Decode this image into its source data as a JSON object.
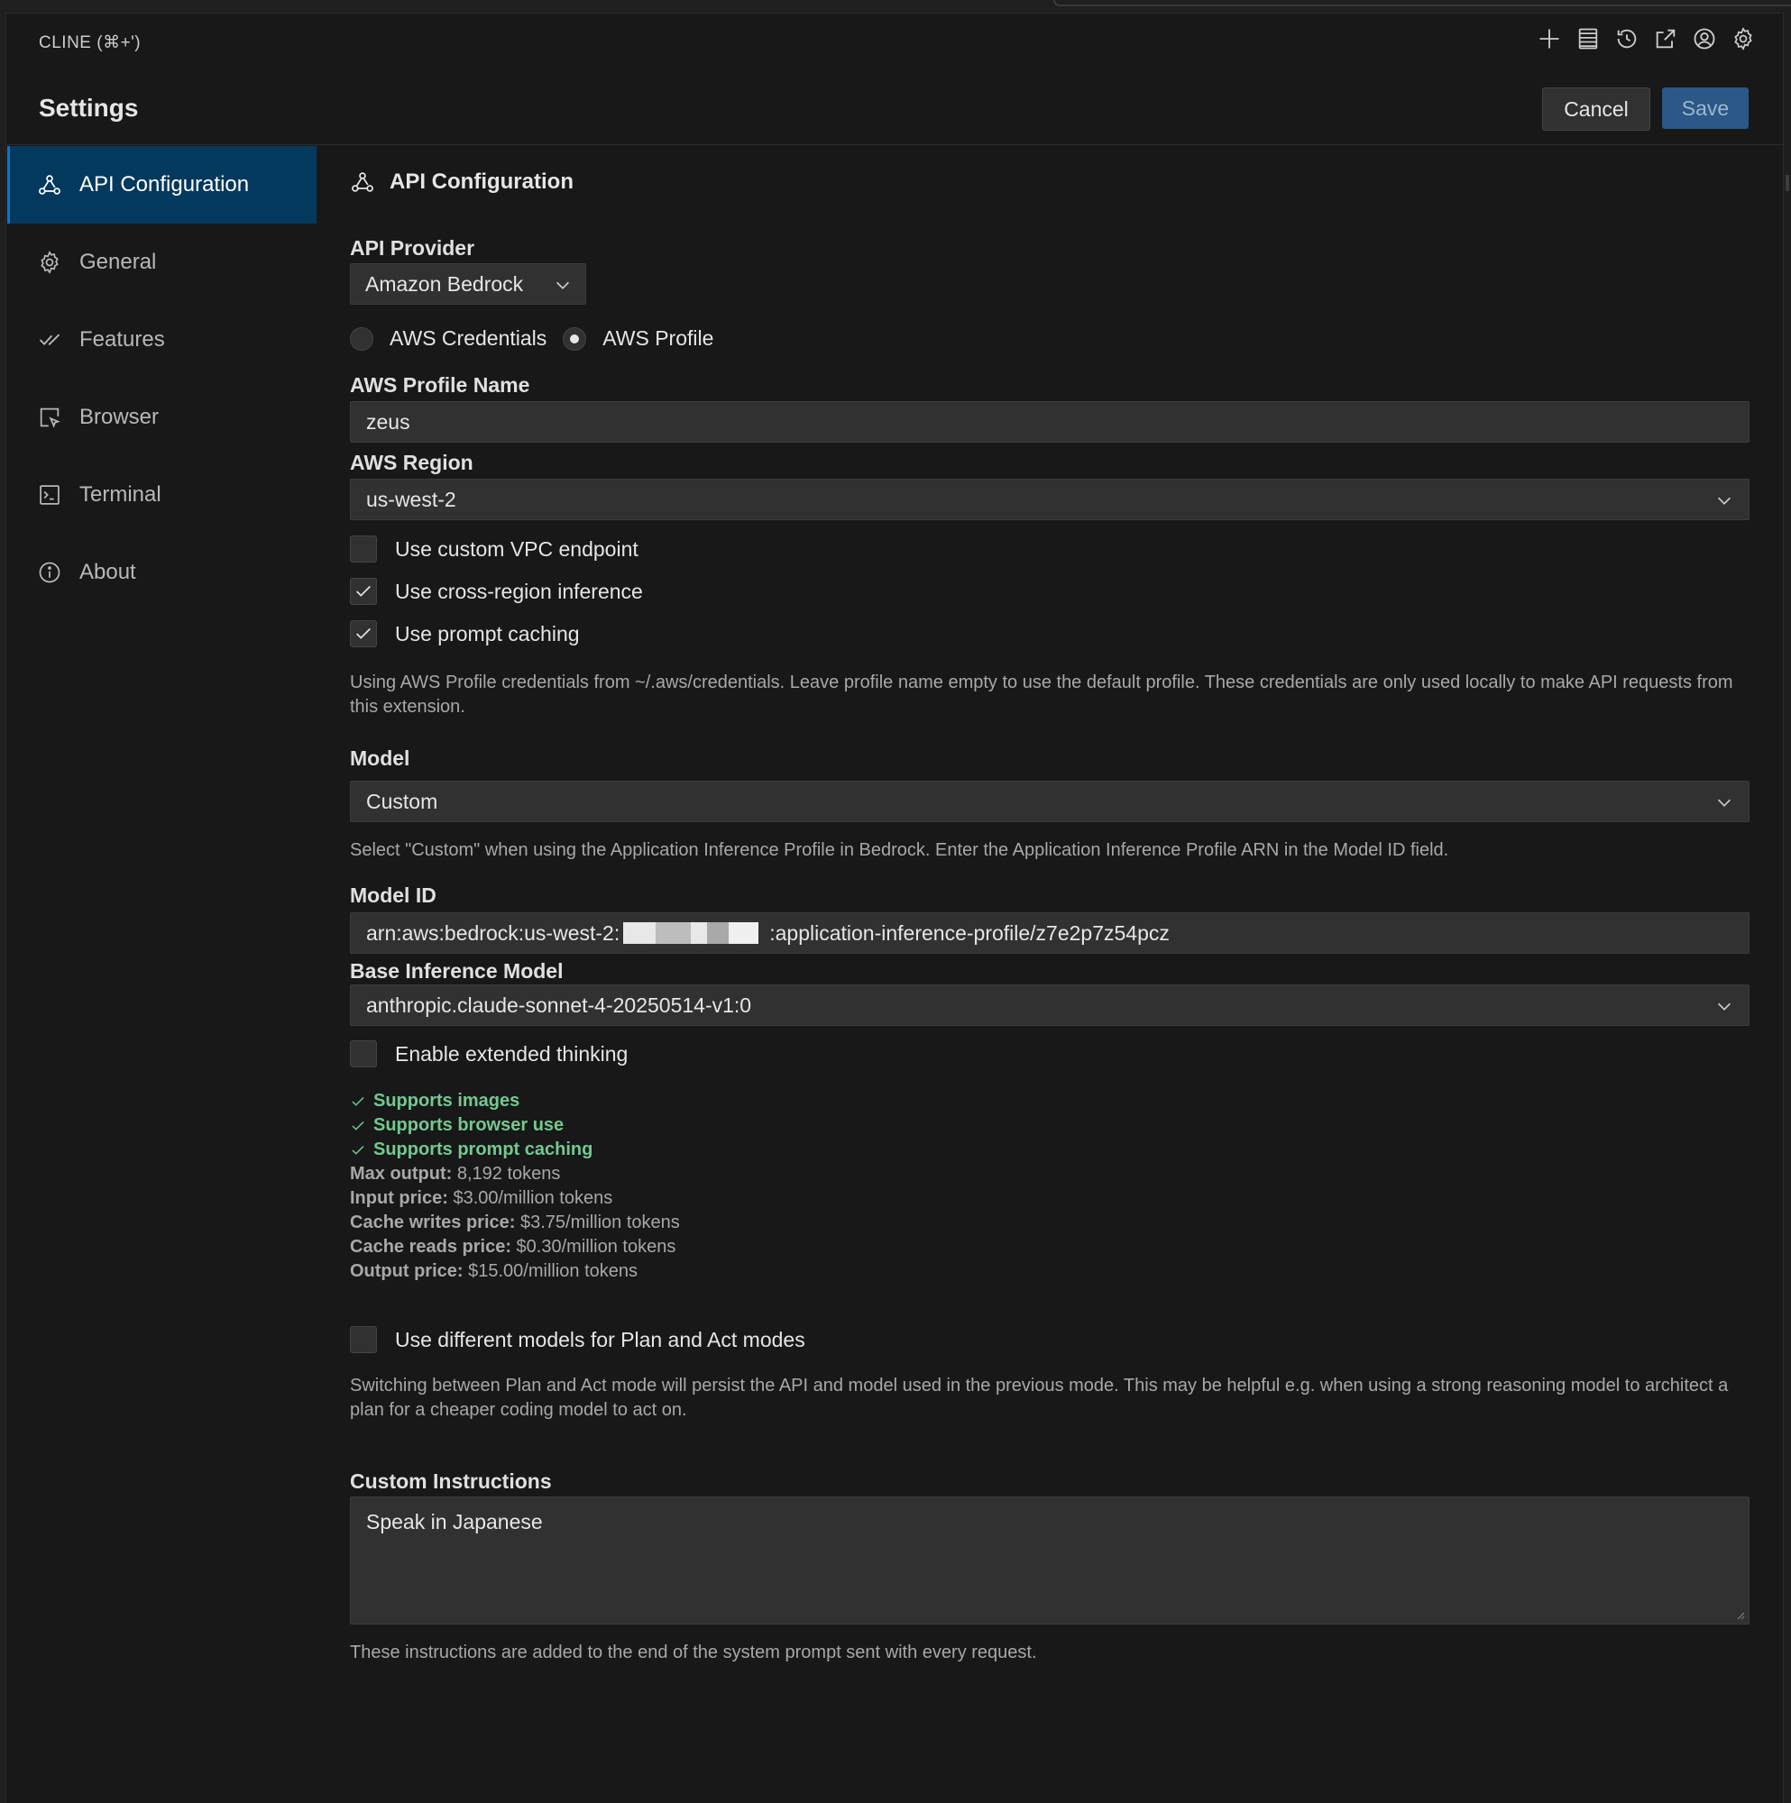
{
  "panel": {
    "title": "CLINE (⌘+')"
  },
  "toolbar": {
    "icons": [
      "plus-icon",
      "server-stack-icon",
      "history-icon",
      "popout-icon",
      "account-icon",
      "gear-icon"
    ]
  },
  "header": {
    "title": "Settings",
    "cancel_label": "Cancel",
    "save_label": "Save"
  },
  "sidebar": {
    "items": [
      {
        "label": "API Configuration",
        "icon": "webhook-icon",
        "active": true
      },
      {
        "label": "General",
        "icon": "gear-icon"
      },
      {
        "label": "Features",
        "icon": "checklist-icon"
      },
      {
        "label": "Browser",
        "icon": "browser-cursor-icon"
      },
      {
        "label": "Terminal",
        "icon": "terminal-icon"
      },
      {
        "label": "About",
        "icon": "info-icon"
      }
    ]
  },
  "main": {
    "section_title": "API Configuration",
    "api_provider": {
      "label": "API Provider",
      "value": "Amazon Bedrock"
    },
    "auth": {
      "option1": "AWS Credentials",
      "option2": "AWS Profile",
      "selected": "AWS Profile"
    },
    "profile_name": {
      "label": "AWS Profile Name",
      "value": "zeus"
    },
    "region": {
      "label": "AWS Region",
      "value": "us-west-2"
    },
    "checks": {
      "vpc": {
        "label": "Use custom VPC endpoint",
        "checked": false
      },
      "cross_region": {
        "label": "Use cross-region inference",
        "checked": true
      },
      "prompt_caching": {
        "label": "Use prompt caching",
        "checked": true
      }
    },
    "profile_note": "Using AWS Profile credentials from ~/.aws/credentials. Leave profile name empty to use the default profile. These credentials are only used locally to make API requests from this extension.",
    "model": {
      "label": "Model",
      "value": "Custom",
      "note": "Select \"Custom\" when using the Application Inference Profile in Bedrock. Enter the Application Inference Profile ARN in the Model ID field."
    },
    "model_id": {
      "label": "Model ID",
      "prefix": "arn:aws:bedrock:us-west-2:",
      "suffix": ":application-inference-profile/z7e2p7z54pcz"
    },
    "base_model": {
      "label": "Base Inference Model",
      "value": "anthropic.claude-sonnet-4-20250514-v1:0"
    },
    "extended_thinking": {
      "label": "Enable extended thinking",
      "checked": false
    },
    "capabilities": [
      "Supports images",
      "Supports browser use",
      "Supports prompt caching"
    ],
    "pricing": [
      {
        "key": "Max output:",
        "value": "8,192 tokens"
      },
      {
        "key": "Input price:",
        "value": "$3.00/million tokens"
      },
      {
        "key": "Cache writes price:",
        "value": "$3.75/million tokens"
      },
      {
        "key": "Cache reads price:",
        "value": "$0.30/million tokens"
      },
      {
        "key": "Output price:",
        "value": "$15.00/million tokens"
      }
    ],
    "plan_act": {
      "label": "Use different models for Plan and Act modes",
      "checked": false,
      "note": "Switching between Plan and Act mode will persist the API and model used in the previous mode. This may be helpful e.g. when using a strong reasoning model to architect a plan for a cheaper coding model to act on."
    },
    "custom_instructions": {
      "label": "Custom Instructions",
      "value": "Speak in Japanese",
      "note": "These instructions are added to the end of the system prompt sent with every request."
    }
  },
  "colors": {
    "accent": "#0078d4",
    "active_bg": "#04395e",
    "save_bg": "#2b5886",
    "success": "#73c991",
    "background": "#181818"
  }
}
